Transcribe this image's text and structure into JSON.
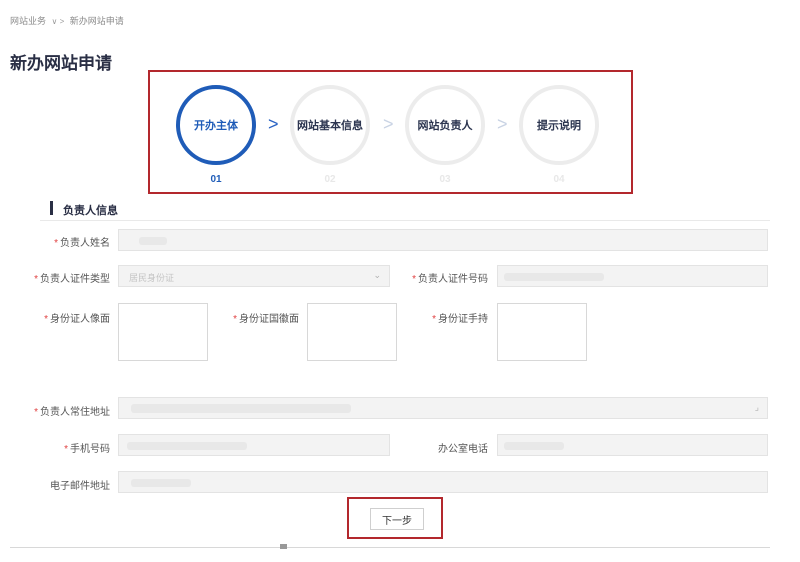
{
  "breadcrumb": {
    "root": "网站业务",
    "separator": "∨ >",
    "current": "新办网站申请"
  },
  "page_title": "新办网站申请",
  "steps": [
    {
      "label": "开办主体",
      "number": "01",
      "active": true
    },
    {
      "label": "网站基本信息",
      "number": "02",
      "active": false
    },
    {
      "label": "网站负责人",
      "number": "03",
      "active": false
    },
    {
      "label": "提示说明",
      "number": "04",
      "active": false
    }
  ],
  "step_arrow": ">",
  "section_title": "负责人信息",
  "required_mark": "*",
  "form": {
    "name_label": "负责人姓名",
    "id_type_label": "负责人证件类型",
    "id_type_value": "居民身份证",
    "id_number_label": "负责人证件号码",
    "id_front_label": "身份证人像面",
    "id_back_label": "身份证国徽面",
    "id_hold_label": "身份证手持",
    "address_label": "负责人常住地址",
    "phone_label": "手机号码",
    "office_phone_label": "办公室电话",
    "email_label": "电子邮件地址"
  },
  "next_button": "下一步",
  "colors": {
    "accent": "#1f5cb8",
    "highlight_box": "#b3282d",
    "required": "#e04040"
  }
}
